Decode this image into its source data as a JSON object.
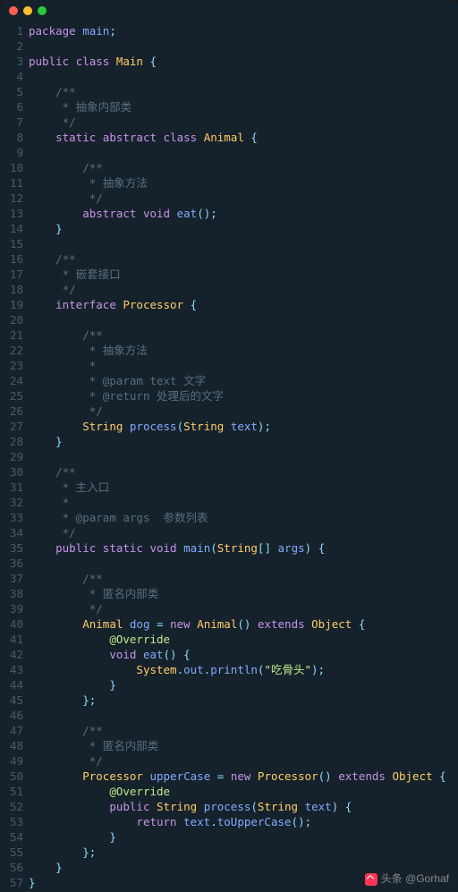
{
  "watermark": {
    "prefix": "头条",
    "at": "@",
    "user": "Gorhaf"
  },
  "titlebar": {
    "dots": [
      "red",
      "yellow",
      "green"
    ]
  },
  "code": {
    "lines": [
      [
        [
          "keyword",
          "package"
        ],
        [
          "plain",
          " "
        ],
        [
          "ident",
          "main"
        ],
        [
          "punct",
          ";"
        ]
      ],
      [],
      [
        [
          "keyword",
          "public"
        ],
        [
          "plain",
          " "
        ],
        [
          "keyword",
          "class"
        ],
        [
          "plain",
          " "
        ],
        [
          "type",
          "Main"
        ],
        [
          "plain",
          " "
        ],
        [
          "punct",
          "{"
        ]
      ],
      [],
      [
        [
          "plain",
          "    "
        ],
        [
          "comment",
          "/**"
        ]
      ],
      [
        [
          "plain",
          "    "
        ],
        [
          "comment",
          " * 抽象内部类"
        ]
      ],
      [
        [
          "plain",
          "    "
        ],
        [
          "comment",
          " */"
        ]
      ],
      [
        [
          "plain",
          "    "
        ],
        [
          "keyword",
          "static"
        ],
        [
          "plain",
          " "
        ],
        [
          "keyword",
          "abstract"
        ],
        [
          "plain",
          " "
        ],
        [
          "keyword",
          "class"
        ],
        [
          "plain",
          " "
        ],
        [
          "type",
          "Animal"
        ],
        [
          "plain",
          " "
        ],
        [
          "punct",
          "{"
        ]
      ],
      [],
      [
        [
          "plain",
          "        "
        ],
        [
          "comment",
          "/**"
        ]
      ],
      [
        [
          "plain",
          "        "
        ],
        [
          "comment",
          " * 抽象方法"
        ]
      ],
      [
        [
          "plain",
          "        "
        ],
        [
          "comment",
          " */"
        ]
      ],
      [
        [
          "plain",
          "        "
        ],
        [
          "keyword",
          "abstract"
        ],
        [
          "plain",
          " "
        ],
        [
          "keyword",
          "void"
        ],
        [
          "plain",
          " "
        ],
        [
          "method",
          "eat"
        ],
        [
          "punct",
          "();"
        ]
      ],
      [
        [
          "plain",
          "    "
        ],
        [
          "punct",
          "}"
        ]
      ],
      [],
      [
        [
          "plain",
          "    "
        ],
        [
          "comment",
          "/**"
        ]
      ],
      [
        [
          "plain",
          "    "
        ],
        [
          "comment",
          " * 嵌套接口"
        ]
      ],
      [
        [
          "plain",
          "    "
        ],
        [
          "comment",
          " */"
        ]
      ],
      [
        [
          "plain",
          "    "
        ],
        [
          "keyword",
          "interface"
        ],
        [
          "plain",
          " "
        ],
        [
          "type",
          "Processor"
        ],
        [
          "plain",
          " "
        ],
        [
          "punct",
          "{"
        ]
      ],
      [],
      [
        [
          "plain",
          "        "
        ],
        [
          "comment",
          "/**"
        ]
      ],
      [
        [
          "plain",
          "        "
        ],
        [
          "comment",
          " * 抽象方法"
        ]
      ],
      [
        [
          "plain",
          "        "
        ],
        [
          "comment",
          " *"
        ]
      ],
      [
        [
          "plain",
          "        "
        ],
        [
          "comment",
          " * @param text 文字"
        ]
      ],
      [
        [
          "plain",
          "        "
        ],
        [
          "comment",
          " * @return 处理后的文字"
        ]
      ],
      [
        [
          "plain",
          "        "
        ],
        [
          "comment",
          " */"
        ]
      ],
      [
        [
          "plain",
          "        "
        ],
        [
          "type",
          "String"
        ],
        [
          "plain",
          " "
        ],
        [
          "method",
          "process"
        ],
        [
          "punct",
          "("
        ],
        [
          "type",
          "String"
        ],
        [
          "plain",
          " "
        ],
        [
          "ident",
          "text"
        ],
        [
          "punct",
          ");"
        ]
      ],
      [
        [
          "plain",
          "    "
        ],
        [
          "punct",
          "}"
        ]
      ],
      [],
      [
        [
          "plain",
          "    "
        ],
        [
          "comment",
          "/**"
        ]
      ],
      [
        [
          "plain",
          "    "
        ],
        [
          "comment",
          " * 主入口"
        ]
      ],
      [
        [
          "plain",
          "    "
        ],
        [
          "comment",
          " *"
        ]
      ],
      [
        [
          "plain",
          "    "
        ],
        [
          "comment",
          " * @param args  参数列表"
        ]
      ],
      [
        [
          "plain",
          "    "
        ],
        [
          "comment",
          " */"
        ]
      ],
      [
        [
          "plain",
          "    "
        ],
        [
          "keyword",
          "public"
        ],
        [
          "plain",
          " "
        ],
        [
          "keyword",
          "static"
        ],
        [
          "plain",
          " "
        ],
        [
          "keyword",
          "void"
        ],
        [
          "plain",
          " "
        ],
        [
          "method",
          "main"
        ],
        [
          "punct",
          "("
        ],
        [
          "type",
          "String"
        ],
        [
          "punct",
          "[]"
        ],
        [
          "plain",
          " "
        ],
        [
          "ident",
          "args"
        ],
        [
          "punct",
          ")"
        ],
        [
          "plain",
          " "
        ],
        [
          "punct",
          "{"
        ]
      ],
      [],
      [
        [
          "plain",
          "        "
        ],
        [
          "comment",
          "/**"
        ]
      ],
      [
        [
          "plain",
          "        "
        ],
        [
          "comment",
          " * 匿名内部类"
        ]
      ],
      [
        [
          "plain",
          "        "
        ],
        [
          "comment",
          " */"
        ]
      ],
      [
        [
          "plain",
          "        "
        ],
        [
          "type",
          "Animal"
        ],
        [
          "plain",
          " "
        ],
        [
          "ident",
          "dog"
        ],
        [
          "plain",
          " "
        ],
        [
          "punct",
          "="
        ],
        [
          "plain",
          " "
        ],
        [
          "keyword",
          "new"
        ],
        [
          "plain",
          " "
        ],
        [
          "type",
          "Animal"
        ],
        [
          "punct",
          "()"
        ],
        [
          "plain",
          " "
        ],
        [
          "keyword",
          "extends"
        ],
        [
          "plain",
          " "
        ],
        [
          "type",
          "Object"
        ],
        [
          "plain",
          " "
        ],
        [
          "punct",
          "{"
        ]
      ],
      [
        [
          "plain",
          "            "
        ],
        [
          "annotation",
          "@Override"
        ]
      ],
      [
        [
          "plain",
          "            "
        ],
        [
          "keyword",
          "void"
        ],
        [
          "plain",
          " "
        ],
        [
          "method",
          "eat"
        ],
        [
          "punct",
          "()"
        ],
        [
          "plain",
          " "
        ],
        [
          "punct",
          "{"
        ]
      ],
      [
        [
          "plain",
          "                "
        ],
        [
          "type",
          "System"
        ],
        [
          "punct",
          "."
        ],
        [
          "ident",
          "out"
        ],
        [
          "punct",
          "."
        ],
        [
          "method",
          "println"
        ],
        [
          "punct",
          "("
        ],
        [
          "string",
          "\"吃骨头\""
        ],
        [
          "punct",
          ");"
        ]
      ],
      [
        [
          "plain",
          "            "
        ],
        [
          "punct",
          "}"
        ]
      ],
      [
        [
          "plain",
          "        "
        ],
        [
          "punct",
          "};"
        ]
      ],
      [],
      [
        [
          "plain",
          "        "
        ],
        [
          "comment",
          "/**"
        ]
      ],
      [
        [
          "plain",
          "        "
        ],
        [
          "comment",
          " * 匿名内部类"
        ]
      ],
      [
        [
          "plain",
          "        "
        ],
        [
          "comment",
          " */"
        ]
      ],
      [
        [
          "plain",
          "        "
        ],
        [
          "type",
          "Processor"
        ],
        [
          "plain",
          " "
        ],
        [
          "ident",
          "upperCase"
        ],
        [
          "plain",
          " "
        ],
        [
          "punct",
          "="
        ],
        [
          "plain",
          " "
        ],
        [
          "keyword",
          "new"
        ],
        [
          "plain",
          " "
        ],
        [
          "type",
          "Processor"
        ],
        [
          "punct",
          "()"
        ],
        [
          "plain",
          " "
        ],
        [
          "keyword",
          "extends"
        ],
        [
          "plain",
          " "
        ],
        [
          "type",
          "Object"
        ],
        [
          "plain",
          " "
        ],
        [
          "punct",
          "{"
        ]
      ],
      [
        [
          "plain",
          "            "
        ],
        [
          "annotation",
          "@Override"
        ]
      ],
      [
        [
          "plain",
          "            "
        ],
        [
          "keyword",
          "public"
        ],
        [
          "plain",
          " "
        ],
        [
          "type",
          "String"
        ],
        [
          "plain",
          " "
        ],
        [
          "method",
          "process"
        ],
        [
          "punct",
          "("
        ],
        [
          "type",
          "String"
        ],
        [
          "plain",
          " "
        ],
        [
          "ident",
          "text"
        ],
        [
          "punct",
          ")"
        ],
        [
          "plain",
          " "
        ],
        [
          "punct",
          "{"
        ]
      ],
      [
        [
          "plain",
          "                "
        ],
        [
          "keyword",
          "return"
        ],
        [
          "plain",
          " "
        ],
        [
          "ident",
          "text"
        ],
        [
          "punct",
          "."
        ],
        [
          "method",
          "toUpperCase"
        ],
        [
          "punct",
          "();"
        ]
      ],
      [
        [
          "plain",
          "            "
        ],
        [
          "punct",
          "}"
        ]
      ],
      [
        [
          "plain",
          "        "
        ],
        [
          "punct",
          "};"
        ]
      ],
      [
        [
          "plain",
          "    "
        ],
        [
          "punct",
          "}"
        ]
      ],
      [
        [
          "punct",
          "}"
        ]
      ]
    ]
  }
}
